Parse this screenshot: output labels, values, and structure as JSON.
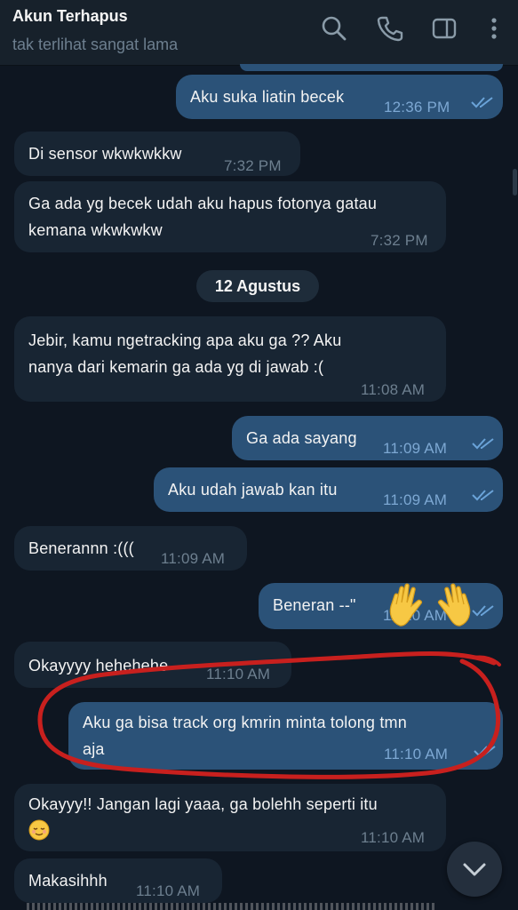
{
  "header": {
    "title": "Akun Terhapus",
    "status": "tak terlihat sangat lama",
    "icons": [
      "search-icon",
      "phone-icon",
      "sidebar-toggle-icon",
      "more-vertical-icon"
    ]
  },
  "date_separator": "12 Agustus",
  "messages": [
    {
      "dir": "out",
      "text": "Aku suka liatin becek",
      "time": "12:36 PM",
      "read": true
    },
    {
      "dir": "in",
      "text": "Di sensor wkwkwkkw",
      "time": "7:32 PM"
    },
    {
      "dir": "in",
      "text": "Ga ada yg becek udah aku hapus fotonya gatau\nkemana wkwkwkw",
      "time": "7:32 PM"
    },
    {
      "dir": "in",
      "text": "Jebir, kamu ngetracking apa aku ga ?? Aku\nnanya dari kemarin ga ada yg di jawab :(",
      "time": "11:08 AM"
    },
    {
      "dir": "out",
      "text": "Ga ada sayang",
      "time": "11:09 AM",
      "read": true
    },
    {
      "dir": "out",
      "text": "Aku udah jawab kan itu",
      "time": "11:09 AM",
      "read": true
    },
    {
      "dir": "in",
      "text": "Benerannn :(((",
      "time": "11:09 AM"
    },
    {
      "dir": "out",
      "text": "Beneran --\"",
      "time": "11:10 AM",
      "read": true,
      "emoji": "waving-hands"
    },
    {
      "dir": "in",
      "text": "Okayyyy hehehehe",
      "time": "11:10 AM"
    },
    {
      "dir": "out",
      "text": "Aku ga bisa track org kmrin minta tolong tmn\naja",
      "time": "11:10 AM",
      "read": true,
      "highlighted": true
    },
    {
      "dir": "in",
      "text": "Okayyy!! Jangan lagi yaaa, ga bolehh seperti itu",
      "time": "11:10 AM",
      "emoji": "relieved-face"
    },
    {
      "dir": "in",
      "text": "Makasihhh",
      "time": "11:10 AM"
    }
  ],
  "colors": {
    "background": "#0e1621",
    "header": "#17212b",
    "incoming_bubble": "#182533",
    "outgoing_bubble": "#2b5278",
    "annotation": "#c8201e"
  },
  "scroll_down_icon": "chevron-down-icon"
}
